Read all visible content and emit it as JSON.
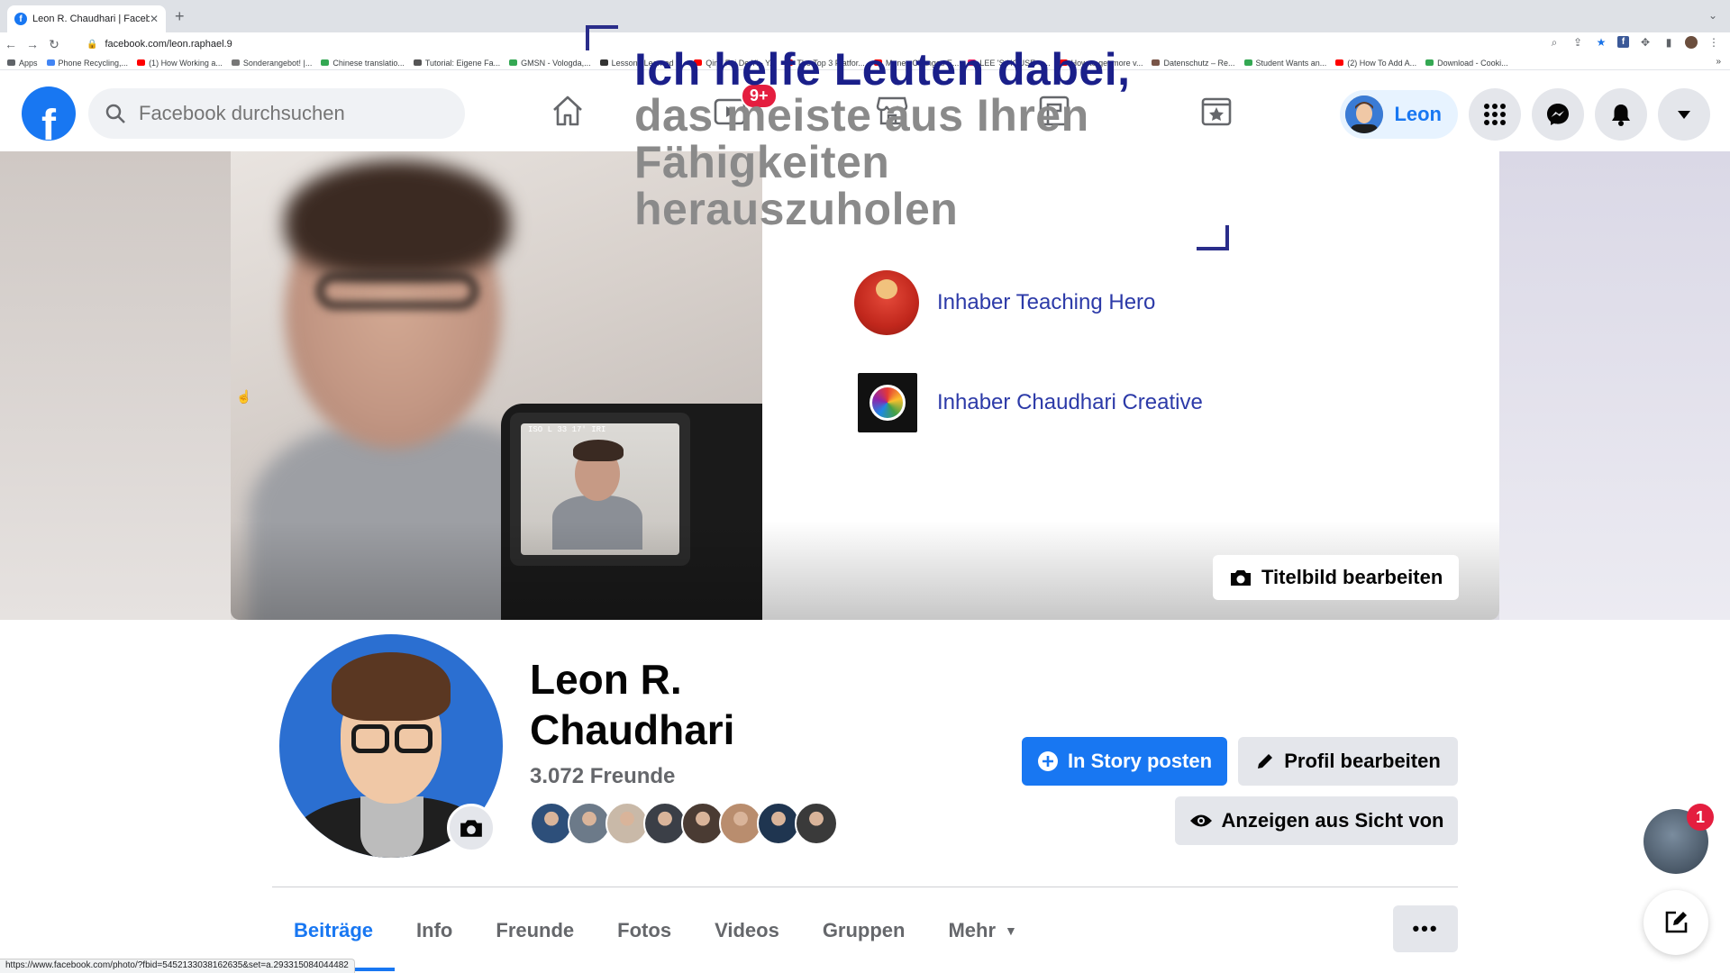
{
  "browser": {
    "tab_title": "Leon R. Chaudhari | Facebook",
    "url": "facebook.com/leon.raphael.9",
    "bookmarks": [
      {
        "label": "Apps",
        "color": "#5f6368"
      },
      {
        "label": "Phone Recycling,...",
        "color": "#4285f4"
      },
      {
        "label": "(1) How Working a...",
        "color": "#ff0000"
      },
      {
        "label": "Sonderangebot! |...",
        "color": "#777777"
      },
      {
        "label": "Chinese translatio...",
        "color": "#34a853"
      },
      {
        "label": "Tutorial: Eigene Fa...",
        "color": "#555555"
      },
      {
        "label": "GMSN - Vologda,...",
        "color": "#34a853"
      },
      {
        "label": "Lessons Learned f...",
        "color": "#333333"
      },
      {
        "label": "Qing Fei De Yi - Y...",
        "color": "#ff0000"
      },
      {
        "label": "The Top 3 Platfor...",
        "color": "#ff0000"
      },
      {
        "label": "Money Changes E...",
        "color": "#ff0000"
      },
      {
        "label": "LEE 'S HOUSE—...",
        "color": "#e91e63"
      },
      {
        "label": "How to get more v...",
        "color": "#ff0000"
      },
      {
        "label": "Datenschutz – Re...",
        "color": "#795548"
      },
      {
        "label": "Student Wants an...",
        "color": "#34a853"
      },
      {
        "label": "(2) How To Add A...",
        "color": "#ff0000"
      },
      {
        "label": "Download - Cooki...",
        "color": "#34a853"
      }
    ],
    "status_url": "https://www.facebook.com/photo/?fbid=5452133038162635&set=a.293315084044482"
  },
  "fbnav": {
    "logo": "f",
    "search_placeholder": "Facebook durchsuchen",
    "watch_badge": "9+",
    "user_name": "Leon",
    "icons": [
      "home-icon",
      "watch-icon",
      "marketplace-icon",
      "groups-icon",
      "gaming-icon",
      "menu-grid-icon",
      "messenger-icon",
      "bell-icon",
      "account-caret-icon"
    ]
  },
  "cover": {
    "headline1": "Ich helfe Leuten dabei,",
    "headline2": "das meiste aus Ihren Fähigkeiten herauszuholen",
    "owner1": "Inhaber Teaching Hero",
    "owner2": "Inhaber Chaudhari Creative",
    "edit_cover_label": "Titelbild bearbeiten",
    "camera_hud": "ISO  L 33  17'  IRI"
  },
  "profile": {
    "name": "Leon R. Chaudhari",
    "friends": "3.072 Freunde",
    "friend_avatar_colors": [
      "#2d4f7a",
      "#6c7a89",
      "#c9b9a8",
      "#3b3f47",
      "#4a3b33",
      "#b98d6e",
      "#1f3550",
      "#3a3a3a"
    ],
    "story_button": "In Story posten",
    "edit_button": "Profil bearbeiten",
    "view_as_button": "Anzeigen aus Sicht von"
  },
  "tabs": [
    {
      "label": "Beiträge",
      "active": true
    },
    {
      "label": "Info",
      "active": false
    },
    {
      "label": "Freunde",
      "active": false
    },
    {
      "label": "Fotos",
      "active": false
    },
    {
      "label": "Videos",
      "active": false
    },
    {
      "label": "Gruppen",
      "active": false
    },
    {
      "label": "Mehr",
      "active": false
    }
  ],
  "more_dots": "•••",
  "chat": {
    "badge": "1"
  },
  "colors": {
    "brand": "#1877f2",
    "badge": "#e41e3f",
    "headline": "#1a1f8a"
  }
}
